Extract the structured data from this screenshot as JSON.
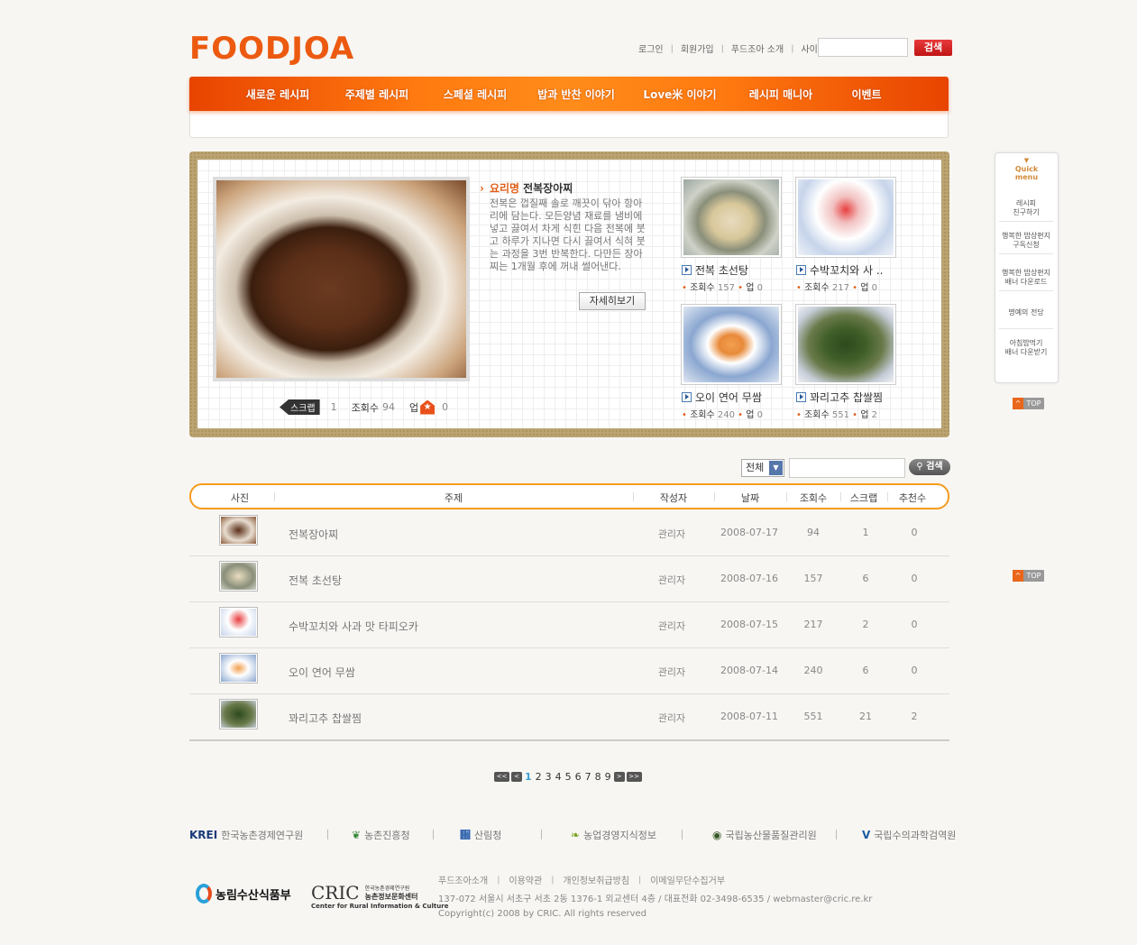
{
  "header": {
    "logo": "FOODJOA",
    "links": [
      "로그인",
      "회원가입",
      "푸드조아 소개",
      "사이트맵"
    ],
    "search_button": "검색"
  },
  "nav": {
    "items": [
      "새로운 레시피",
      "주제별 레시피",
      "스페셜 레시피",
      "밥과 반찬 이야기",
      "Love米 이야기",
      "레시피 매니아",
      "이벤트"
    ]
  },
  "featured": {
    "label": "요리명",
    "title": "전복장아찌",
    "description": "전복은 껍질째 솔로 깨끗이 닦아 항아리에 담는다. 모든양념 재료를 냄비에 넣고 끓여서 차게 식힌 다음 전복에 붓고 하루가 지나면 다시 끓여서 식혀 붓는 과정을 3번 반복한다. 다만든 장아찌는 1개월 후에 꺼내 썰어낸다.",
    "detail_button": "자세히보기",
    "scrap_label": "스크랩",
    "scrap_count": "1",
    "views_label": "조회수",
    "views_count": "94",
    "up_label": "업",
    "up_count": "0"
  },
  "thumbs": [
    {
      "title": "전복 초선탕",
      "views_label": "조회수",
      "views": "157",
      "up_label": "업",
      "up": "0"
    },
    {
      "title": "수박꼬치와 사 ..",
      "views_label": "조회수",
      "views": "217",
      "up_label": "업",
      "up": "0"
    },
    {
      "title": "오이 연어 무쌈",
      "views_label": "조회수",
      "views": "240",
      "up_label": "업",
      "up": "0"
    },
    {
      "title": "꽈리고추 찹쌀찜",
      "views_label": "조회수",
      "views": "551",
      "up_label": "업",
      "up": "2"
    }
  ],
  "quick_menu": {
    "title_1": "Quick",
    "title_2": "menu",
    "items": [
      {
        "l1": "레시피",
        "l2": "친구하기"
      },
      {
        "l1": "행복한 밥상편지",
        "l2": "구독신청"
      },
      {
        "l1": "행복한 밥상편지",
        "l2": "배너 다운로드"
      },
      {
        "l1": "명예의 전당",
        "l2": ""
      },
      {
        "l1": "아침밥먹기",
        "l2": "배너 다운받기"
      }
    ],
    "top_label": "TOP"
  },
  "list_search": {
    "select_value": "전체",
    "button": "검색"
  },
  "table": {
    "headers": [
      "사진",
      "주제",
      "작성자",
      "날짜",
      "조회수",
      "스크랩",
      "추천수"
    ],
    "rows": [
      {
        "subject": "전복장아찌",
        "author": "관리자",
        "date": "2008-07-17",
        "views": "94",
        "scrap": "1",
        "recommend": "0"
      },
      {
        "subject": "전복 초선탕",
        "author": "관리자",
        "date": "2008-07-16",
        "views": "157",
        "scrap": "6",
        "recommend": "0"
      },
      {
        "subject": "수박꼬치와 사과 맛 타피오카",
        "author": "관리자",
        "date": "2008-07-15",
        "views": "217",
        "scrap": "2",
        "recommend": "0"
      },
      {
        "subject": "오이 연어 무쌈",
        "author": "관리자",
        "date": "2008-07-14",
        "views": "240",
        "scrap": "6",
        "recommend": "0"
      },
      {
        "subject": "꽈리고추 찹쌀찜",
        "author": "관리자",
        "date": "2008-07-11",
        "views": "551",
        "scrap": "21",
        "recommend": "2"
      }
    ]
  },
  "pagination": {
    "pages": [
      "1",
      "2",
      "3",
      "4",
      "5",
      "6",
      "7",
      "8",
      "9"
    ],
    "current": "1"
  },
  "footer": {
    "partners": [
      {
        "mark": "KREI",
        "name": "한국농촌경제연구원"
      },
      {
        "mark": "",
        "name": "농촌진흥청"
      },
      {
        "mark": "",
        "name": "산림청"
      },
      {
        "mark": "",
        "name": "농업경영지식정보"
      },
      {
        "mark": "",
        "name": "국립농산물품질관리원"
      },
      {
        "mark": "",
        "name": "국립수의과학검역원"
      }
    ],
    "ministry": "농림수산식품부",
    "cric_mark": "CRIC",
    "cric_name_1": "한국농촌경제연구원",
    "cric_name_2": "농촌정보문화센터",
    "cric_en": "Center for Rural Information & Culture",
    "links": [
      "푸드조아소개",
      "이용약관",
      "개인정보취급방침",
      "이메일무단수집거부"
    ],
    "address": "137-072 서울시 서초구 서초 2동 1376-1 외교센터 4층 / 대표전화 02-3498-6535 / webmaster@cric.re.kr",
    "copyright": "Copyright(c) 2008 by CRIC. All rights reserved"
  }
}
